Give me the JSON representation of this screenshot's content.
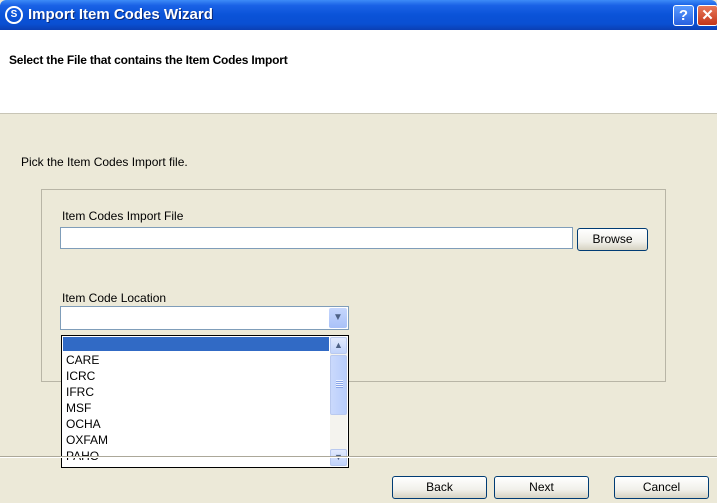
{
  "window": {
    "title": "Import Item Codes Wizard",
    "help_label": "?",
    "close_label": "✕"
  },
  "header": {
    "title": "Select the File that contains the Item Codes Import"
  },
  "main": {
    "instruction": "Pick the Item Codes Import file.",
    "file_label": "Item Codes Import File",
    "file_value": "",
    "browse_label": "Browse",
    "location_label": "Item Code Location",
    "location_selected": ""
  },
  "dropdown": {
    "items": [
      "",
      "CARE",
      "ICRC",
      "IFRC",
      "MSF",
      "OCHA",
      "OXFAM",
      "PAHO"
    ],
    "highlighted_index": 0
  },
  "footer": {
    "back_label": "Back",
    "next_label": "Next",
    "cancel_label": "Cancel"
  }
}
